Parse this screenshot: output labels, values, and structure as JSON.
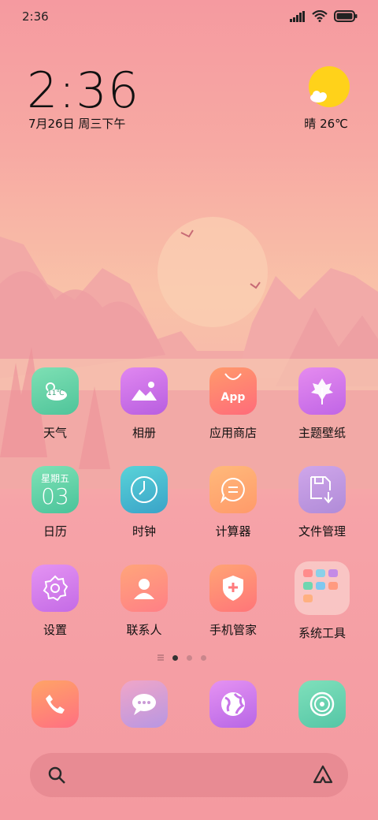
{
  "status": {
    "time": "2:36"
  },
  "clock": {
    "time": "2:36",
    "date": "7月26日 周三下午"
  },
  "weather": {
    "text": "晴 26℃",
    "icon": "sunny-cloud-icon"
  },
  "apps": [
    {
      "label": "天气",
      "icon": "weather-icon",
      "badge": "11℃"
    },
    {
      "label": "相册",
      "icon": "gallery-icon"
    },
    {
      "label": "应用商店",
      "icon": "app-store-icon",
      "badge": "App"
    },
    {
      "label": "主题壁纸",
      "icon": "theme-icon"
    },
    {
      "label": "日历",
      "icon": "calendar-icon",
      "weekday": "星期五",
      "day": "03"
    },
    {
      "label": "时钟",
      "icon": "clock-icon"
    },
    {
      "label": "计算器",
      "icon": "calculator-icon"
    },
    {
      "label": "文件管理",
      "icon": "file-manager-icon"
    },
    {
      "label": "设置",
      "icon": "settings-icon"
    },
    {
      "label": "联系人",
      "icon": "contacts-icon"
    },
    {
      "label": "手机管家",
      "icon": "security-icon"
    },
    {
      "label": "系统工具",
      "icon": "folder-icon"
    }
  ],
  "pager": {
    "pages": 3,
    "current": 0
  },
  "dock": [
    {
      "icon": "phone-icon"
    },
    {
      "icon": "messages-icon"
    },
    {
      "icon": "browser-icon"
    },
    {
      "icon": "music-icon"
    }
  ],
  "colors": {
    "accent_sun": "#ffd21a",
    "background_top": "#f59aa0",
    "background_mid": "#f9c2a8"
  }
}
